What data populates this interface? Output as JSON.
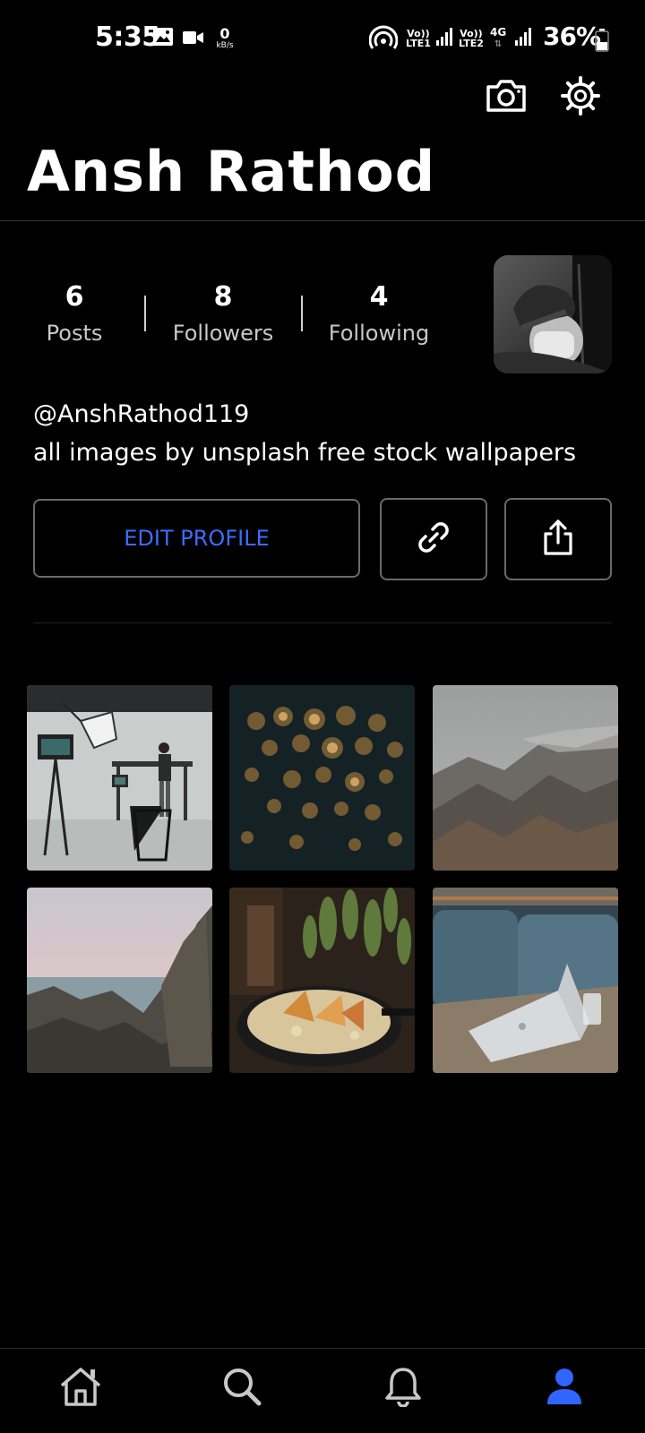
{
  "status_bar": {
    "time": "5:35",
    "speed_value": "0",
    "speed_unit": "kB/s",
    "sim1_line1": "Vo))",
    "sim1_line2": "LTE1",
    "sim2_line1": "Vo))",
    "sim2_line2": "LTE2",
    "network_type": "4G",
    "battery": "36%",
    "icons": [
      "gallery-icon",
      "video-camera-icon",
      "hotspot-icon",
      "signal-icon",
      "signal-icon",
      "battery-icon"
    ]
  },
  "header": {
    "camera_icon": "camera-icon",
    "settings_icon": "gear-icon"
  },
  "profile": {
    "name": "Ansh Rathod",
    "handle": "@AnshRathod119",
    "bio": "all images by unsplash free stock wallpapers",
    "stats": [
      {
        "value": "6",
        "label": "Posts"
      },
      {
        "value": "8",
        "label": "Followers"
      },
      {
        "value": "4",
        "label": "Following"
      }
    ]
  },
  "actions": {
    "edit_label": "EDIT PROFILE",
    "link_icon": "link-icon",
    "share_icon": "share-icon"
  },
  "colors": {
    "accent": "#3f6bff",
    "background": "#000000",
    "nav_active": "#2f66ff"
  },
  "posts": [
    {
      "subject": "photo studio"
    },
    {
      "subject": "bokeh lights"
    },
    {
      "subject": "misty mountains"
    },
    {
      "subject": "rocky coast"
    },
    {
      "subject": "food plate"
    },
    {
      "subject": "laptop on table"
    }
  ],
  "bottom_nav": [
    {
      "icon": "home-icon",
      "active": false
    },
    {
      "icon": "search-icon",
      "active": false
    },
    {
      "icon": "bell-icon",
      "active": false
    },
    {
      "icon": "profile-icon",
      "active": true
    }
  ]
}
